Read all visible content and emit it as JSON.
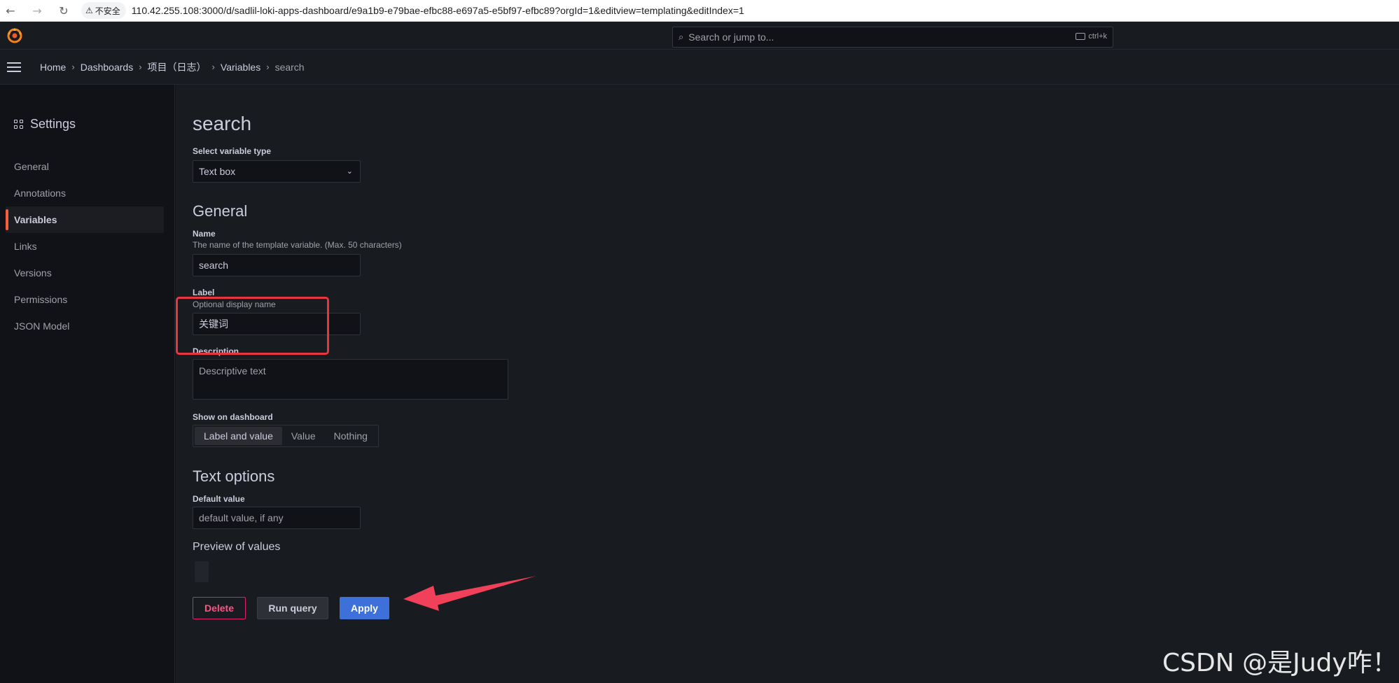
{
  "browser": {
    "insecure_label": "不安全",
    "url": "110.42.255.108:3000/d/sadlil-loki-apps-dashboard/e9a1b9-e79bae-efbc88-e697a5-e5bf97-efbc89?orgId=1&editview=templating&editIndex=1"
  },
  "topbar": {
    "search_placeholder": "Search or jump to...",
    "shortcut": "ctrl+k"
  },
  "breadcrumb": {
    "items": [
      "Home",
      "Dashboards",
      "项目（日志）",
      "Variables",
      "search"
    ]
  },
  "sidebar": {
    "title": "Settings",
    "items": [
      {
        "label": "General"
      },
      {
        "label": "Annotations"
      },
      {
        "label": "Variables"
      },
      {
        "label": "Links"
      },
      {
        "label": "Versions"
      },
      {
        "label": "Permissions"
      },
      {
        "label": "JSON Model"
      }
    ],
    "active": "Variables"
  },
  "main": {
    "title": "search",
    "variable_type": {
      "label": "Select variable type",
      "value": "Text box"
    },
    "general": {
      "title": "General",
      "name": {
        "label": "Name",
        "description": "The name of the template variable. (Max. 50 characters)",
        "value": "search"
      },
      "label_field": {
        "label": "Label",
        "description": "Optional display name",
        "value": "关键词"
      },
      "description": {
        "label": "Description",
        "placeholder": "Descriptive text"
      },
      "show_on_dashboard": {
        "label": "Show on dashboard",
        "options": [
          "Label and value",
          "Value",
          "Nothing"
        ],
        "selected": "Label and value"
      }
    },
    "text_options": {
      "title": "Text options",
      "default_value": {
        "label": "Default value",
        "placeholder": "default value, if any"
      }
    },
    "preview": {
      "title": "Preview of values"
    },
    "buttons": {
      "delete": "Delete",
      "run_query": "Run query",
      "apply": "Apply"
    }
  },
  "watermark": "CSDN @是Judy咋！",
  "colors": {
    "accent": "#f55f3e",
    "apply": "#3d71d9",
    "delete": "#e0226e",
    "annotation_red": "#e8363f"
  }
}
